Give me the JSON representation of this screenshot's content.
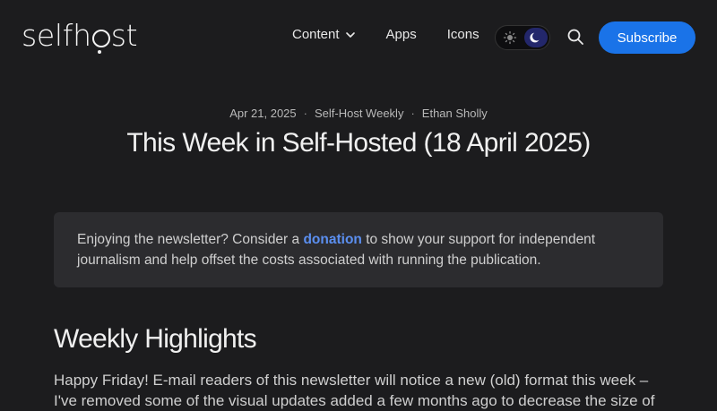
{
  "header": {
    "logo_left": "selfh",
    "logo_right": "st",
    "nav": [
      {
        "label": "Content",
        "has_dropdown": true
      },
      {
        "label": "Apps"
      },
      {
        "label": "Icons"
      }
    ],
    "theme": "dark",
    "subscribe_label": "Subscribe",
    "accent": "#1a73e8"
  },
  "post": {
    "date": "Apr 21, 2025",
    "category": "Self-Host Weekly",
    "author": "Ethan Sholly",
    "title": "This Week in Self-Hosted (18 April 2025)"
  },
  "callout": {
    "prefix": "Enjoying the newsletter? Consider a ",
    "link_text": "donation",
    "suffix": " to show your support for independent journalism and help offset the costs associated with running the publication."
  },
  "section": {
    "heading": "Weekly Highlights",
    "paragraph": "Happy Friday! E-mail readers of this newsletter will notice a new (old) format this week – I've removed some of the visual updates added a few months ago to decrease the size of"
  }
}
